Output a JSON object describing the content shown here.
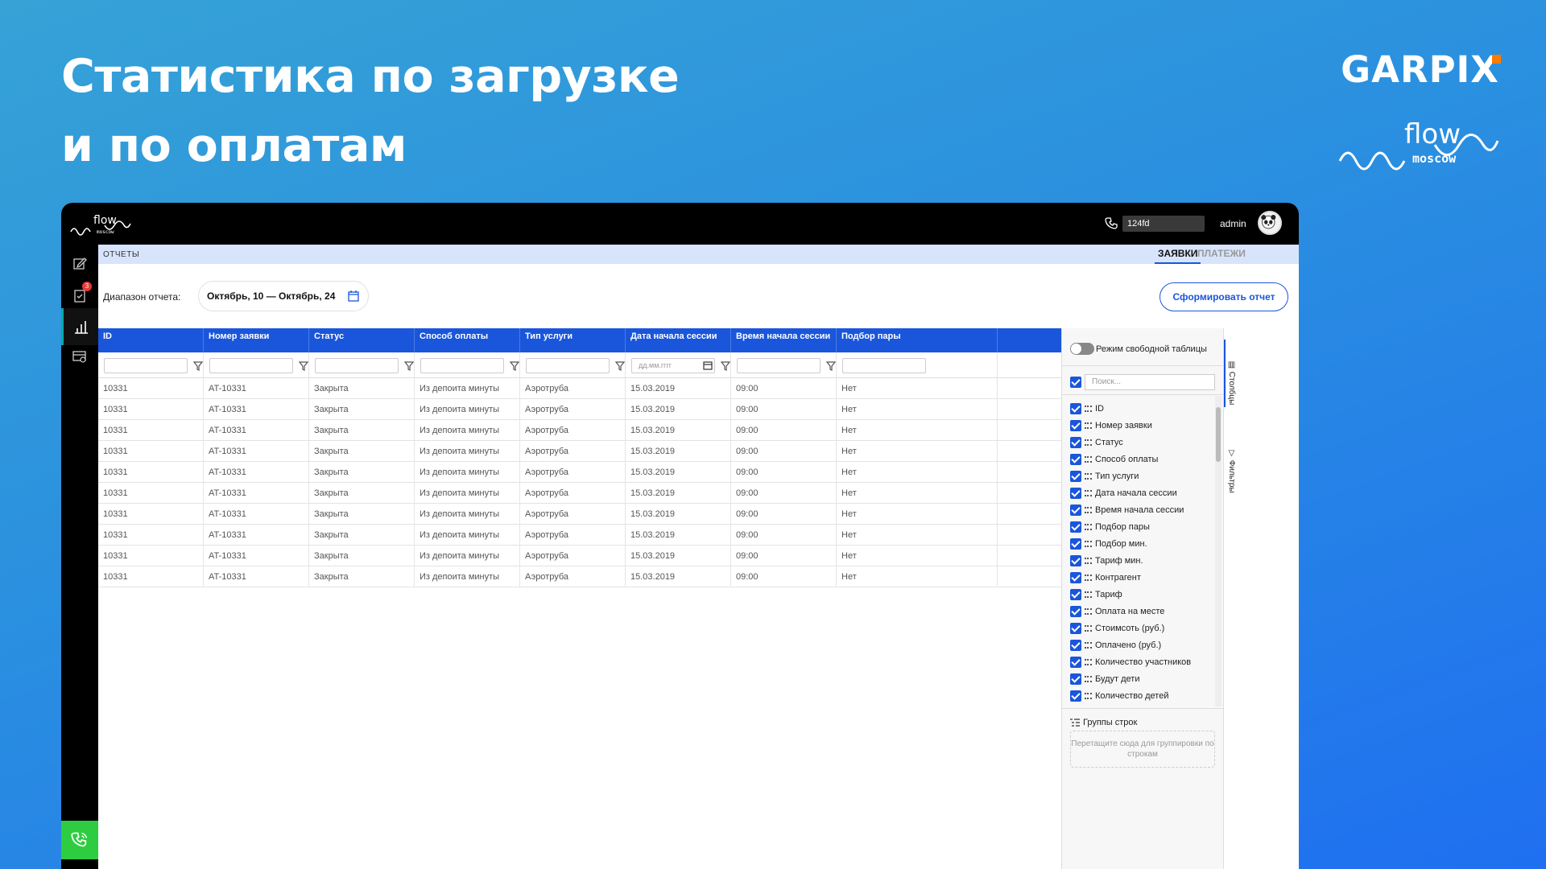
{
  "hero": {
    "line1": "Статистика по загрузке",
    "line2": "и по оплатам"
  },
  "brand": {
    "garpix": "GARPIX",
    "flow": "flow",
    "moscow": "moscow"
  },
  "topbar": {
    "phone_value": "124fd",
    "user": "admin"
  },
  "sidebar": {
    "badge": "3"
  },
  "crumb": "ОТЧЕТЫ",
  "tabs": {
    "orders": "ЗАЯВКИ",
    "payments": "ПЛАТЕЖИ"
  },
  "range": {
    "label": "Диапазон отчета:",
    "value": "Октябрь, 10 — Октябрь, 24"
  },
  "report_button": "Сформировать отчет",
  "date_placeholder": "дд.мм.гггг",
  "columns": [
    "ID",
    "Номер заявки",
    "Статус",
    "Способ оплаты",
    "Тип услуги",
    "Дата начала сессии",
    "Время начала сессии",
    "Подбор пары"
  ],
  "rows": [
    [
      "10331",
      "AT-10331",
      "Закрыта",
      "Из депоита минуты",
      "Аэротруба",
      "15.03.2019",
      "09:00",
      "Нет"
    ],
    [
      "10331",
      "AT-10331",
      "Закрыта",
      "Из депоита минуты",
      "Аэротруба",
      "15.03.2019",
      "09:00",
      "Нет"
    ],
    [
      "10331",
      "AT-10331",
      "Закрыта",
      "Из депоита минуты",
      "Аэротруба",
      "15.03.2019",
      "09:00",
      "Нет"
    ],
    [
      "10331",
      "AT-10331",
      "Закрыта",
      "Из депоита минуты",
      "Аэротруба",
      "15.03.2019",
      "09:00",
      "Нет"
    ],
    [
      "10331",
      "AT-10331",
      "Закрыта",
      "Из депоита минуты",
      "Аэротруба",
      "15.03.2019",
      "09:00",
      "Нет"
    ],
    [
      "10331",
      "AT-10331",
      "Закрыта",
      "Из депоита минуты",
      "Аэротруба",
      "15.03.2019",
      "09:00",
      "Нет"
    ],
    [
      "10331",
      "AT-10331",
      "Закрыта",
      "Из депоита минуты",
      "Аэротруба",
      "15.03.2019",
      "09:00",
      "Нет"
    ],
    [
      "10331",
      "AT-10331",
      "Закрыта",
      "Из депоита минуты",
      "Аэротруба",
      "15.03.2019",
      "09:00",
      "Нет"
    ],
    [
      "10331",
      "AT-10331",
      "Закрыта",
      "Из депоита минуты",
      "Аэротруба",
      "15.03.2019",
      "09:00",
      "Нет"
    ],
    [
      "10331",
      "AT-10331",
      "Закрыта",
      "Из депоита минуты",
      "Аэротруба",
      "15.03.2019",
      "09:00",
      "Нет"
    ]
  ],
  "panel": {
    "free_table_label": "Режим свободной таблицы",
    "search_placeholder": "Поиск...",
    "column_items": [
      "ID",
      "Номер заявки",
      "Статус",
      "Способ оплаты",
      "Тип услуги",
      "Дата начала сессии",
      "Время начала сессии",
      "Подбор пары",
      "Подбор мин.",
      "Тариф мин.",
      "Контрагент",
      "Тариф",
      "Оплата на месте",
      "Стоимсоть (руб.)",
      "Оплачено (руб.)",
      "Количество участников",
      "Будут дети",
      "Количество детей"
    ],
    "groups_label": "Группы строк",
    "dropzone_text": "Перетащите сюда для группировки по строкам",
    "tab_columns": "Столбцы",
    "tab_filters": "Фильтры"
  },
  "colors": {
    "accent": "#1a56db",
    "call": "#2ecc40",
    "badge": "#e53935",
    "brand_dot": "#ff7a00"
  }
}
